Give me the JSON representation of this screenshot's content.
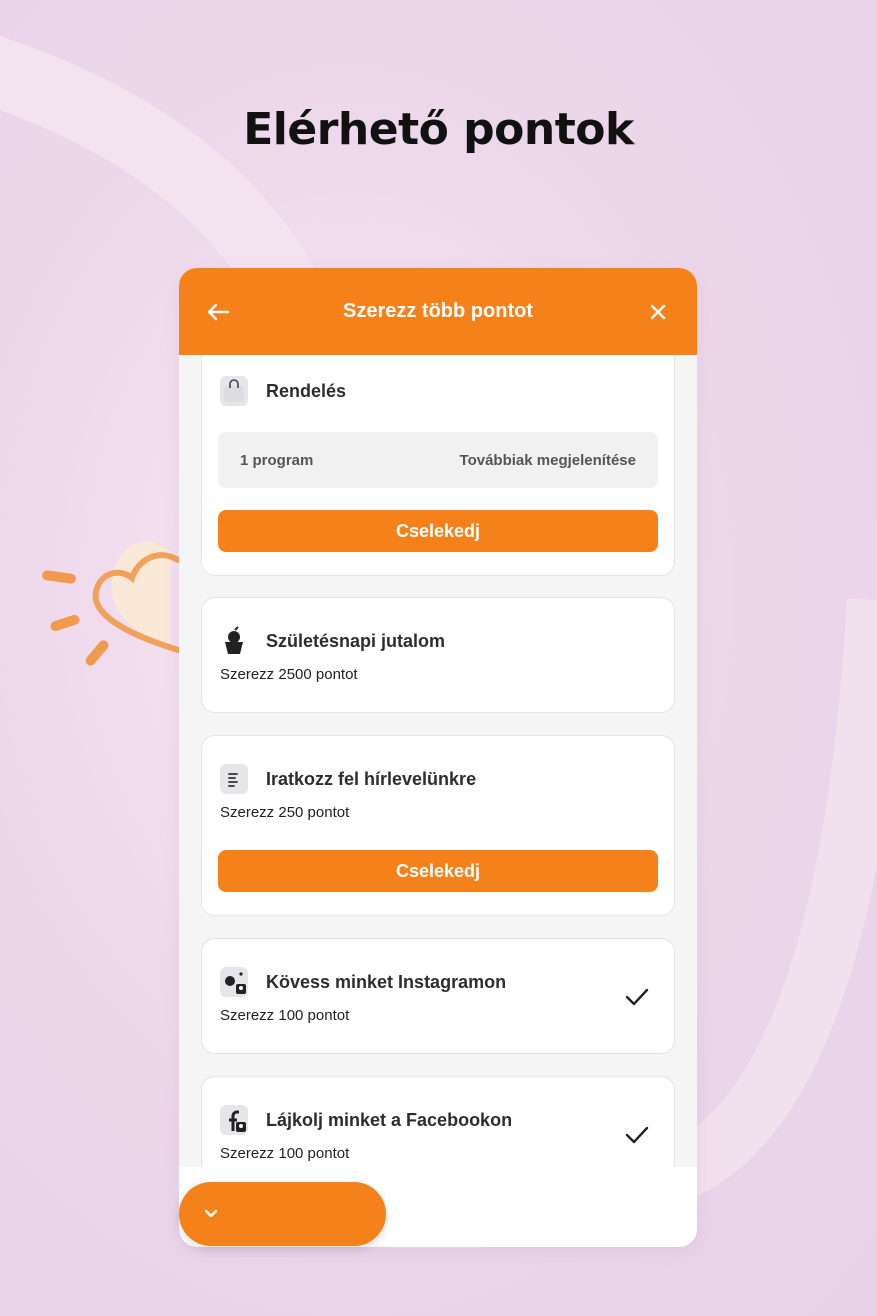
{
  "page": {
    "title": "Elérhető pontok"
  },
  "widget": {
    "header": {
      "title": "Szerezz több pontot",
      "back_icon": "arrow-left-icon",
      "close_icon": "close-icon",
      "accent": "#f4811a"
    },
    "cards": [
      {
        "title": "Rendelés",
        "icon": "shopping-bag-icon",
        "program_count": "1 program",
        "show_more": "Továbbiak megjelenítése",
        "action": "Cselekedj"
      },
      {
        "title": "Születésnapi jutalom",
        "icon": "cupcake-icon",
        "subtitle": "Szerezz 2500 pontot"
      },
      {
        "title": "Iratkozz fel hírlevelünkre",
        "icon": "document-icon",
        "subtitle": "Szerezz 250 pontot",
        "action": "Cselekedj"
      },
      {
        "title": "Kövess minket Instagramon",
        "icon": "instagram-user-icon",
        "subtitle": "Szerezz 100 pontot",
        "status_icon": "checkmark-icon"
      },
      {
        "title": "Lájkolj minket a Facebookon",
        "icon": "facebook-user-icon",
        "subtitle": "Szerezz 100 pontot",
        "status_icon": "checkmark-icon"
      }
    ]
  },
  "fab": {
    "icon": "chevron-down-icon"
  }
}
